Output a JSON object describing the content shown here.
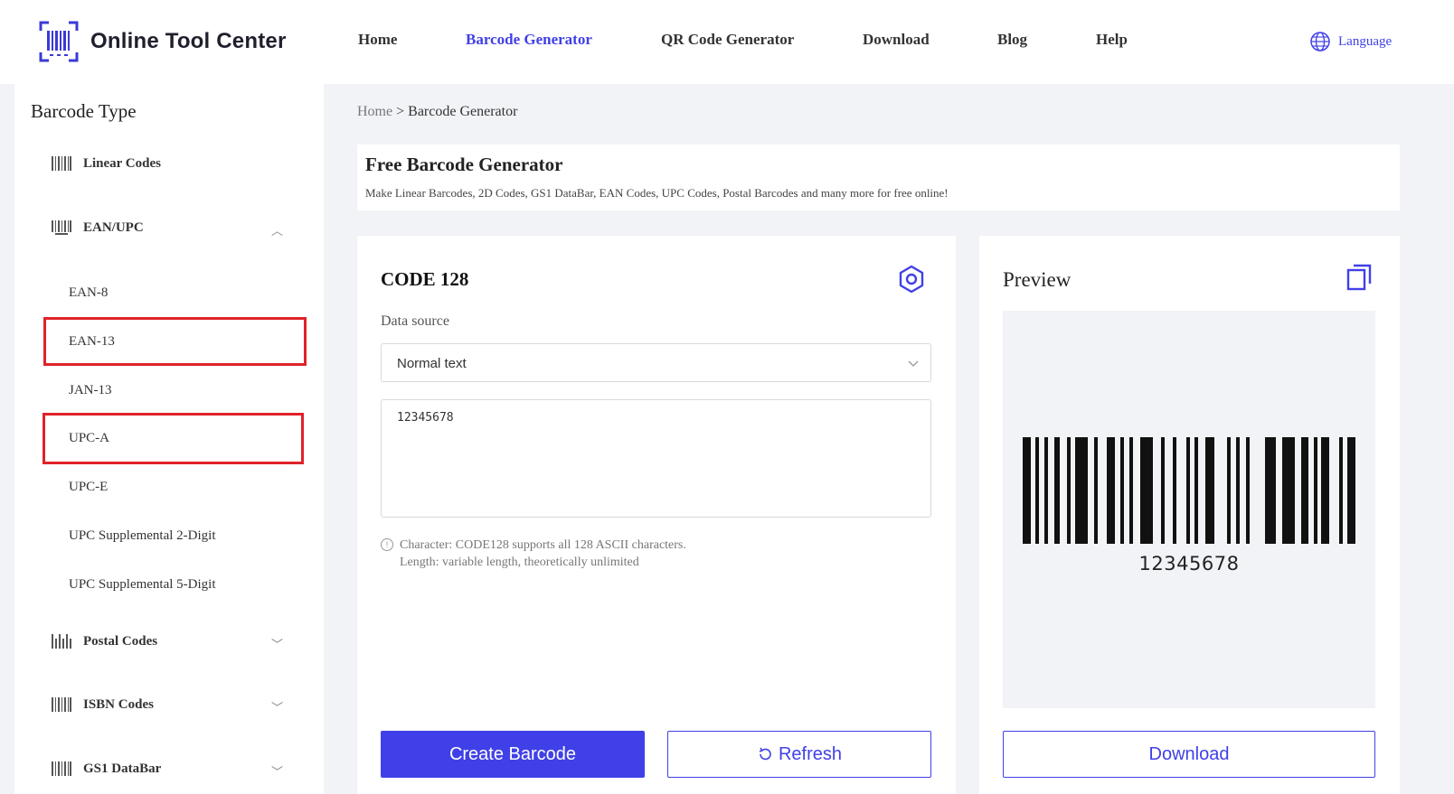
{
  "header": {
    "logo_text": "Online Tool Center",
    "nav": [
      {
        "label": "Home",
        "active": false
      },
      {
        "label": "Barcode Generator",
        "active": true
      },
      {
        "label": "QR Code Generator",
        "active": false
      },
      {
        "label": "Download",
        "active": false
      },
      {
        "label": "Blog",
        "active": false
      },
      {
        "label": "Help",
        "active": false
      }
    ],
    "language_label": "Language"
  },
  "sidebar": {
    "title": "Barcode Type",
    "categories": {
      "linear": {
        "label": "Linear Codes",
        "icon": "barcode-icon"
      },
      "ean_upc": {
        "label": "EAN/UPC",
        "icon": "barcode-icon",
        "expanded": true
      },
      "postal": {
        "label": "Postal Codes",
        "icon": "postal-barcode-icon",
        "expanded": false
      },
      "isbn": {
        "label": "ISBN Codes",
        "icon": "barcode-icon",
        "expanded": false
      },
      "gs1": {
        "label": "GS1 DataBar",
        "icon": "barcode-icon",
        "expanded": false
      }
    },
    "ean_upc_items": [
      "EAN-8",
      "EAN-13",
      "JAN-13",
      "UPC-A",
      "UPC-E",
      "UPC Supplemental 2-Digit",
      "UPC Supplemental 5-Digit"
    ],
    "highlighted_items": [
      "EAN-13",
      "UPC-A"
    ],
    "highlight_color": "#e0222a"
  },
  "breadcrumb": {
    "home": "Home",
    "separator": ">",
    "current": "Barcode Generator"
  },
  "intro": {
    "title": "Free Barcode Generator",
    "subtitle": "Make Linear Barcodes, 2D Codes, GS1 DataBar, EAN Codes, UPC Codes, Postal Barcodes and many more for free online!"
  },
  "generator": {
    "code_type": "CODE 128",
    "data_source_label": "Data source",
    "data_source_value": "Normal text",
    "input_value": "12345678",
    "hint_line1": "Character: CODE128 supports all 128 ASCII characters.",
    "hint_line2": "Length: variable length, theoretically unlimited",
    "create_label": "Create Barcode",
    "refresh_label": "Refresh"
  },
  "preview": {
    "title": "Preview",
    "barcode_text": "12345678",
    "download_label": "Download"
  },
  "colors": {
    "accent": "#4040e8",
    "background": "#f2f3f7"
  }
}
